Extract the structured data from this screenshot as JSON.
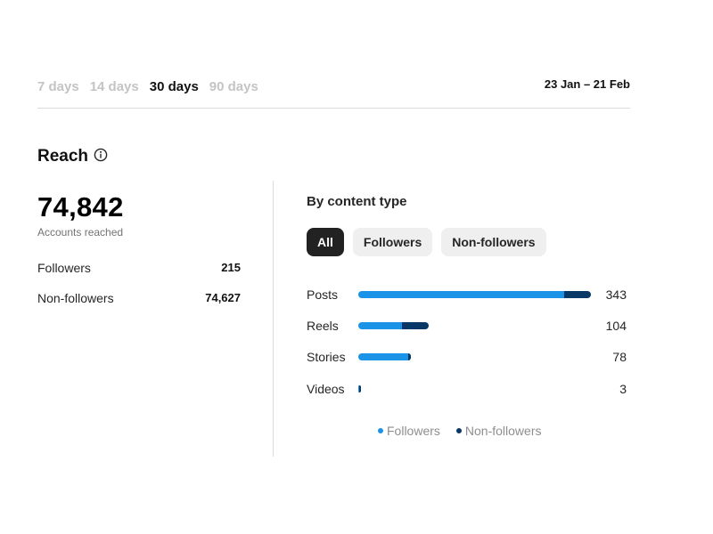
{
  "period_tabs": [
    {
      "label": "7 days",
      "active": false
    },
    {
      "label": "14 days",
      "active": false
    },
    {
      "label": "30 days",
      "active": true
    },
    {
      "label": "90 days",
      "active": false
    }
  ],
  "date_range": "23 Jan – 21 Feb",
  "reach": {
    "title": "Reach",
    "info_icon": "info-circle-icon",
    "accounts_reached": "74,842",
    "accounts_reached_label": "Accounts reached",
    "breakdown": [
      {
        "label": "Followers",
        "value": "215"
      },
      {
        "label": "Non-followers",
        "value": "74,627"
      }
    ]
  },
  "by_content_type": {
    "title": "By content type",
    "filters": [
      {
        "label": "All",
        "active": true
      },
      {
        "label": "Followers",
        "active": false
      },
      {
        "label": "Non-followers",
        "active": false
      }
    ],
    "colors": {
      "followers": "#1b93e6",
      "non_followers": "#0a3866"
    }
  },
  "chart_data": {
    "type": "bar",
    "orientation": "horizontal",
    "stacked": true,
    "categories": [
      "Posts",
      "Reels",
      "Stories",
      "Videos"
    ],
    "totals": [
      "343",
      "104",
      "78",
      "3"
    ],
    "series": [
      {
        "name": "Followers",
        "values": [
          304,
          65,
          74,
          1
        ]
      },
      {
        "name": "Non-followers",
        "values": [
          39,
          39,
          4,
          2
        ]
      }
    ],
    "xlim": [
      0,
      343
    ],
    "legend": [
      "Followers",
      "Non-followers"
    ],
    "legend_position": "bottom"
  }
}
